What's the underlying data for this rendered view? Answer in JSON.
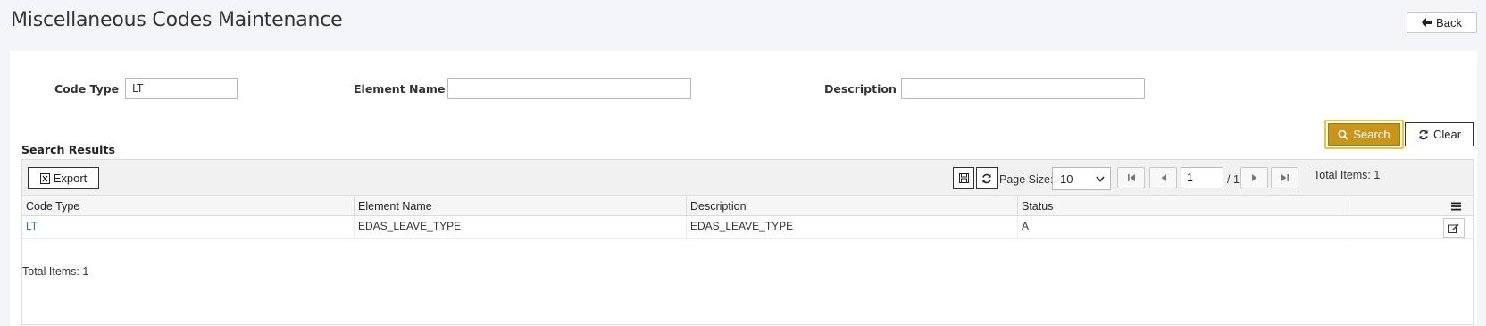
{
  "header": {
    "title": "Miscellaneous Codes Maintenance",
    "back_label": "Back"
  },
  "filters": {
    "code_type_label": "Code Type",
    "code_type_value": "LT",
    "element_name_label": "Element Name",
    "element_name_value": "",
    "description_label": "Description",
    "description_value": ""
  },
  "actions": {
    "search_label": "Search",
    "clear_label": "Clear"
  },
  "results": {
    "title": "Search Results",
    "export_label": "Export",
    "page_size_label": "Page Size:",
    "page_size_value": "10",
    "page_current": "1",
    "page_total": "/ 1",
    "total_items": "Total Items: 1",
    "columns": [
      "Code Type",
      "Element Name",
      "Description",
      "Status"
    ],
    "rows": [
      {
        "code_type": "LT",
        "element_name": "EDAS_LEAVE_TYPE",
        "description": "EDAS_LEAVE_TYPE",
        "status": "A"
      }
    ],
    "footer_total": "Total Items: 1"
  }
}
